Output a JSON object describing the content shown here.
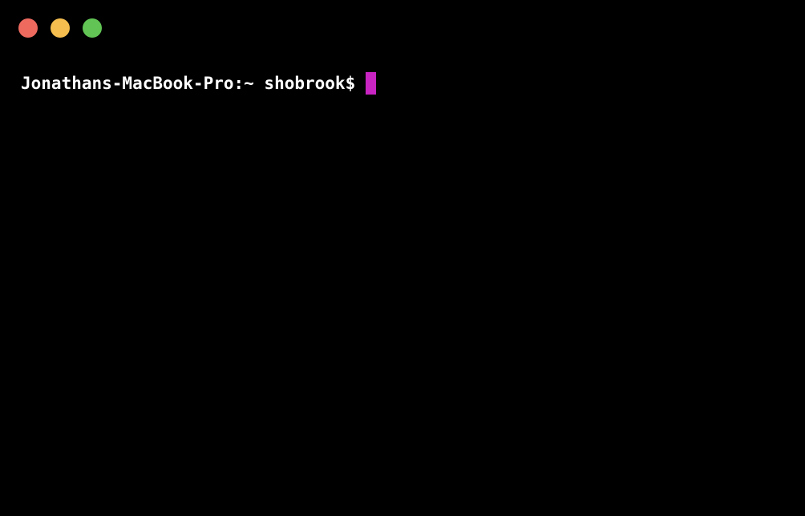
{
  "window": {
    "buttons": {
      "close_color": "#ee6a5f",
      "minimize_color": "#f5be4f",
      "zoom_color": "#61c454"
    }
  },
  "terminal": {
    "prompt": "Jonathans-MacBook-Pro:~ shobrook$",
    "input": "",
    "cursor_color": "#c724c1",
    "background": "#000000",
    "text_color": "#ffffff"
  }
}
